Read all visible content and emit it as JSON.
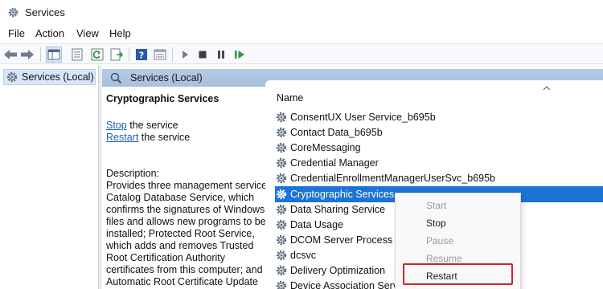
{
  "window": {
    "title": "Services",
    "icon": "gear-icon"
  },
  "menu": {
    "items": [
      "File",
      "Action",
      "View",
      "Help"
    ]
  },
  "toolbar": {
    "icons": [
      "back-arrow-icon",
      "forward-arrow-icon",
      "show-hide-tree-icon",
      "properties-icon",
      "refresh-icon",
      "export-list-icon",
      "help-icon",
      "view-icon",
      "start-service-icon",
      "stop-service-icon",
      "pause-service-icon",
      "resume-service-icon"
    ]
  },
  "tree": {
    "item": "Services (Local)"
  },
  "right_header": {
    "label": "Services (Local)"
  },
  "description_panel": {
    "service_name": "Cryptographic Services",
    "stop_link": "Stop",
    "stop_rest": " the service",
    "restart_link": "Restart",
    "restart_rest": " the service",
    "description_label": "Description:",
    "description_lines": [
      "Provides three management services:",
      "Catalog Database Service, which",
      "confirms the signatures of Windows",
      "files and allows new programs to be",
      "installed; Protected Root Service,",
      "which adds and removes Trusted",
      "Root Certification Authority",
      "certificates from this computer; and",
      "Automatic Root Certificate Update"
    ]
  },
  "services_list": {
    "column_header": "Name",
    "rows": [
      {
        "name": "ConsentUX User Service_b695b",
        "selected": false
      },
      {
        "name": "Contact Data_b695b",
        "selected": false
      },
      {
        "name": "CoreMessaging",
        "selected": false
      },
      {
        "name": "Credential Manager",
        "selected": false
      },
      {
        "name": "CredentialEnrollmentManagerUserSvc_b695b",
        "selected": false
      },
      {
        "name": "Cryptographic Services",
        "selected": true
      },
      {
        "name": "Data Sharing Service",
        "selected": false
      },
      {
        "name": "Data Usage",
        "selected": false
      },
      {
        "name": "DCOM Server Process La",
        "selected": false
      },
      {
        "name": "dcsvc",
        "selected": false
      },
      {
        "name": "Delivery Optimization",
        "selected": false
      },
      {
        "name": "Device Association Servic",
        "selected": false
      }
    ]
  },
  "context_menu": {
    "items": [
      {
        "label": "Start",
        "enabled": false
      },
      {
        "label": "Stop",
        "enabled": true
      },
      {
        "label": "Pause",
        "enabled": false
      },
      {
        "label": "Resume",
        "enabled": false
      },
      {
        "label": "Restart",
        "enabled": true,
        "highlighted": true
      }
    ]
  },
  "colors": {
    "selection": "#1b73d6",
    "link": "#1d5fb8",
    "highlight_border": "#c8262c",
    "header_bar": "#b5cbe6"
  }
}
